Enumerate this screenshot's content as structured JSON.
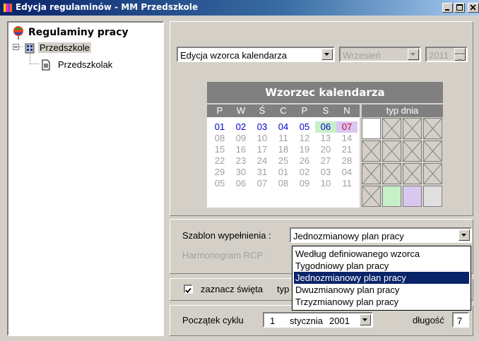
{
  "window": {
    "title": "Edycja regulaminów - MM Przedszkole"
  },
  "tree": {
    "root_label": "Regulaminy pracy",
    "child_label": "Przedszkole",
    "grandchild_label": "Przedszkolak"
  },
  "top": {
    "mode_value": "Edycja wzorca kalendarza",
    "month_value": "Wrzesień",
    "year_value": "2011"
  },
  "calendar": {
    "title": "Wzorzec kalendarza",
    "weekdays": [
      "P",
      "W",
      "Ś",
      "C",
      "P",
      "S",
      "N"
    ],
    "type_header": "typ dnia",
    "rows": [
      [
        "01",
        "02",
        "03",
        "04",
        "05",
        "06",
        "07"
      ],
      [
        "08",
        "09",
        "10",
        "11",
        "12",
        "13",
        "14"
      ],
      [
        "15",
        "16",
        "17",
        "18",
        "19",
        "20",
        "21"
      ],
      [
        "22",
        "23",
        "24",
        "25",
        "26",
        "27",
        "28"
      ],
      [
        "29",
        "30",
        "31",
        "01",
        "02",
        "03",
        "04"
      ],
      [
        "05",
        "06",
        "07",
        "08",
        "09",
        "10",
        "11"
      ]
    ],
    "colors": {
      "active": "#0000cc",
      "sunday": "#cc0033",
      "inactive": "#a0a0a0",
      "saturday_bg": "#c8f0c8",
      "sunday_bg": "#d8c8f0"
    }
  },
  "template": {
    "label": "Szablon wypełnienia :",
    "value": "Jednozmianowy plan pracy",
    "rcp_label": "Harmonogram RCP :",
    "options": [
      "Według definiowanego wzorca",
      "Tygodniowy plan pracy",
      "Jednozmianowy plan pracy",
      "Dwuzmianowy plan pracy",
      "Trzyzmianowy plan pracy"
    ]
  },
  "holidays": {
    "label": "zaznacz święta",
    "suffix": "typ"
  },
  "cycle": {
    "label": "Początek cyklu",
    "day": "1",
    "month": "stycznia",
    "year": "2001",
    "length_label": "długość",
    "length_value": "7"
  }
}
